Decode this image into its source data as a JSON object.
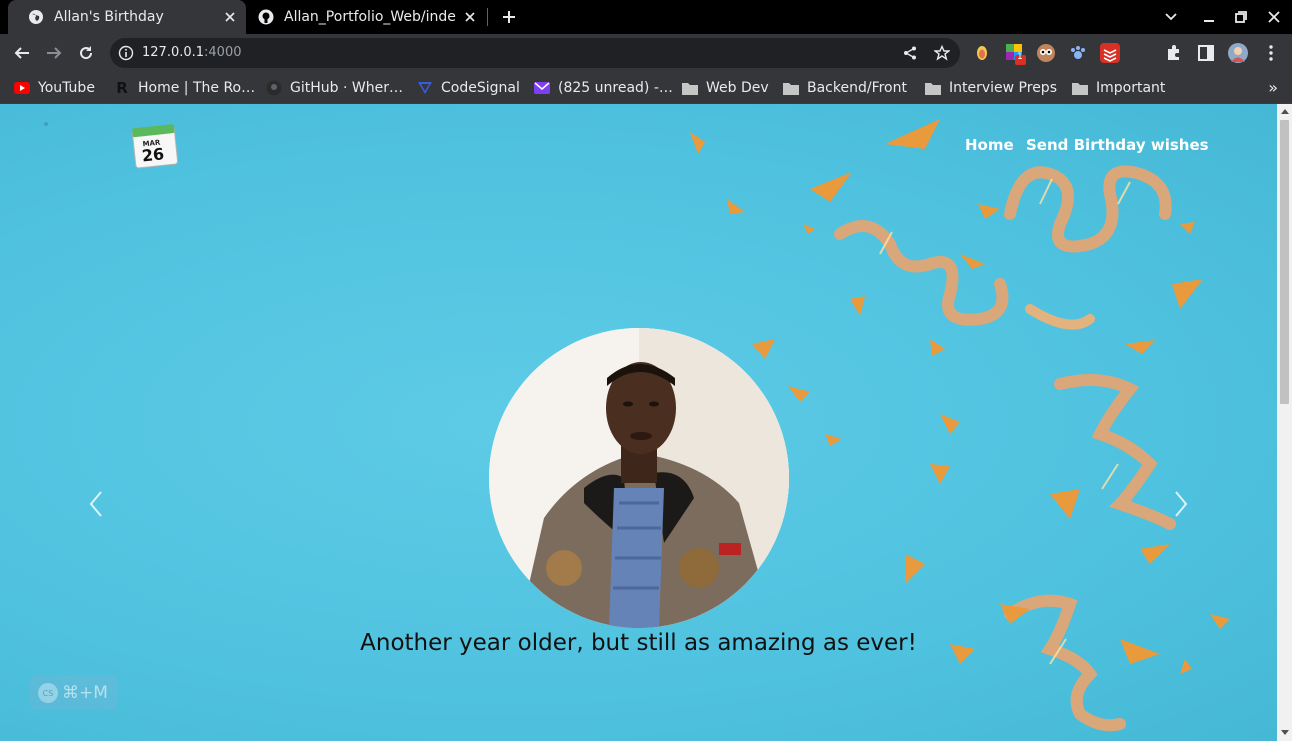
{
  "browser": {
    "tabs": [
      {
        "title": "Allan's Birthday",
        "active": true
      },
      {
        "title": "Allan_Portfolio_Web/inde",
        "active": false
      }
    ],
    "url_host": "127.0.0.1",
    "url_port": ":4000",
    "bookmarks": [
      {
        "label": "YouTube",
        "icon": "youtube-icon"
      },
      {
        "label": "Home | The Ro…",
        "icon": "r-icon"
      },
      {
        "label": "GitHub · Wher…",
        "icon": "github-icon"
      },
      {
        "label": "CodeSignal",
        "icon": "codesignal-icon"
      },
      {
        "label": "(825 unread) -…",
        "icon": "mail-icon"
      },
      {
        "label": "Web Dev",
        "icon": "folder-icon"
      },
      {
        "label": "Backend/Front",
        "icon": "folder-icon"
      },
      {
        "label": "Interview Preps",
        "icon": "folder-icon"
      },
      {
        "label": "Important",
        "icon": "folder-icon"
      }
    ],
    "extension_badge": "1"
  },
  "site": {
    "logo": {
      "month": "MAR",
      "day": "26"
    },
    "nav": {
      "home": "Home",
      "wishes": "Send Birthday wishes"
    },
    "caption": "Another year older, but still as amazing as ever!",
    "shortcut_badge": {
      "logo": "CS",
      "keys": "⌘+M"
    }
  },
  "colors": {
    "page_bg": "#4fc2df",
    "confetti_gold": "#e89a3c",
    "ribbon": "#d9a77a"
  }
}
